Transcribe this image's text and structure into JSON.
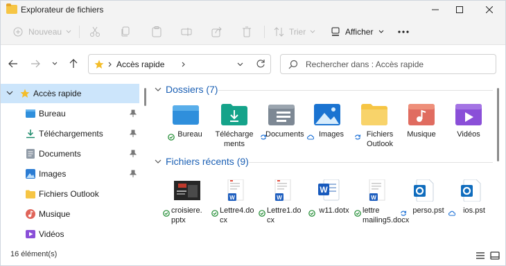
{
  "window": {
    "title": "Explorateur de fichiers"
  },
  "toolbar": {
    "new_label": "Nouveau",
    "sort_label": "Trier",
    "view_label": "Afficher"
  },
  "address": {
    "location": "Accès rapide"
  },
  "search": {
    "placeholder": "Rechercher dans : Accès rapide"
  },
  "sidebar": {
    "items": [
      {
        "label": "Accès rapide",
        "icon": "star-icon"
      },
      {
        "label": "Bureau",
        "icon": "desktop-folder-icon"
      },
      {
        "label": "Téléchargements",
        "icon": "download-icon"
      },
      {
        "label": "Documents",
        "icon": "documents-folder-icon"
      },
      {
        "label": "Images",
        "icon": "images-folder-icon"
      },
      {
        "label": "Fichiers Outlook",
        "icon": "folder-icon"
      },
      {
        "label": "Musique",
        "icon": "music-icon"
      },
      {
        "label": "Vidéos",
        "icon": "video-icon"
      }
    ]
  },
  "folders": {
    "header": "Dossiers (7)",
    "items": [
      {
        "label": "Bureau",
        "status": "synced"
      },
      {
        "label": "Téléchargements",
        "status": "none"
      },
      {
        "label": "Documents",
        "status": "syncing"
      },
      {
        "label": "Images",
        "status": "cloud"
      },
      {
        "label": "Fichiers Outlook",
        "status": "syncing"
      },
      {
        "label": "Musique",
        "status": "none"
      },
      {
        "label": "Vidéos",
        "status": "none"
      }
    ]
  },
  "recent": {
    "header": "Fichiers récents (9)",
    "items": [
      {
        "label": "croisiere.pptx",
        "status": "synced"
      },
      {
        "label": "Lettre4.docx",
        "status": "synced"
      },
      {
        "label": "Lettre1.docx",
        "status": "synced"
      },
      {
        "label": "w11.dotx",
        "status": "synced"
      },
      {
        "label": "lettre mailing5.docx",
        "status": "synced"
      },
      {
        "label": "perso.pst",
        "status": "syncing"
      },
      {
        "label": "ios.pst",
        "status": "cloud"
      }
    ]
  },
  "statusbar": {
    "count": "16 élément(s)"
  },
  "colors": {
    "accent": "#0a64c8",
    "selection": "#cce5fb",
    "folder": "#f6c544"
  }
}
